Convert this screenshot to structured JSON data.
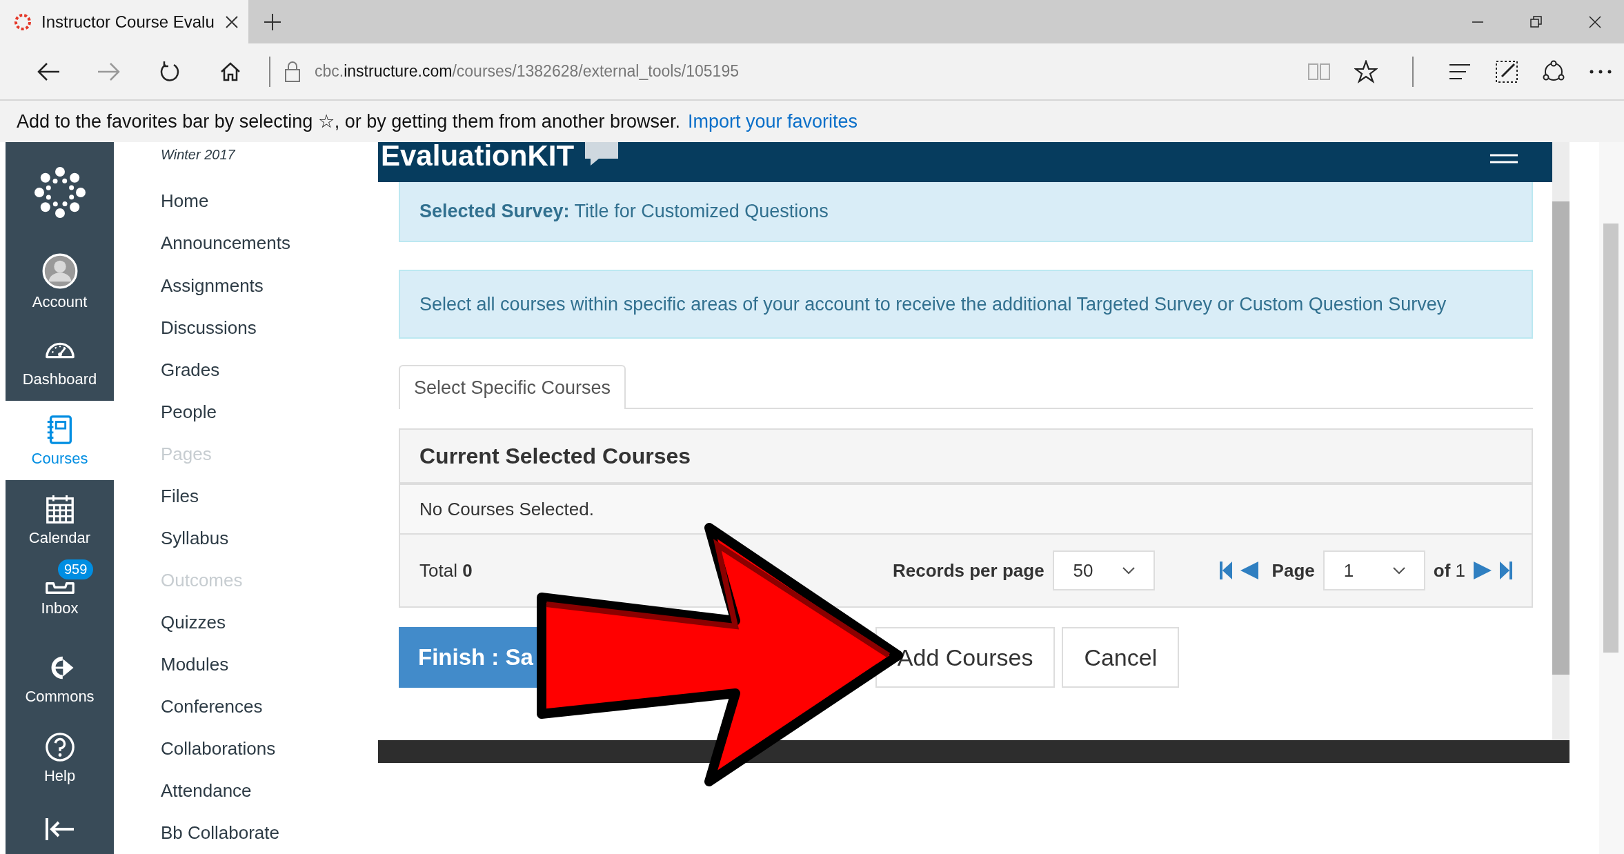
{
  "browser": {
    "tab_title": "Instructor Course Evalu",
    "url_prefix": "cbc.",
    "url_domain": "instructure.com",
    "url_path": "/courses/1382628/external_tools/105195"
  },
  "favorites_bar": {
    "message": "Add to the favorites bar by selecting ☆, or by getting them from another browser.",
    "link": "Import your favorites"
  },
  "global_nav": {
    "items": [
      {
        "label": "Account",
        "selected": false
      },
      {
        "label": "Dashboard",
        "selected": false
      },
      {
        "label": "Courses",
        "selected": true
      },
      {
        "label": "Calendar",
        "selected": false
      },
      {
        "label": "Inbox",
        "selected": false,
        "badge": "959"
      },
      {
        "label": "Commons",
        "selected": false
      },
      {
        "label": "Help",
        "selected": false
      }
    ]
  },
  "course_nav": {
    "term": "Winter 2017",
    "items": [
      {
        "label": "Home",
        "disabled": false
      },
      {
        "label": "Announcements",
        "disabled": false
      },
      {
        "label": "Assignments",
        "disabled": false
      },
      {
        "label": "Discussions",
        "disabled": false
      },
      {
        "label": "Grades",
        "disabled": false
      },
      {
        "label": "People",
        "disabled": false
      },
      {
        "label": "Pages",
        "disabled": true
      },
      {
        "label": "Files",
        "disabled": false
      },
      {
        "label": "Syllabus",
        "disabled": false
      },
      {
        "label": "Outcomes",
        "disabled": true
      },
      {
        "label": "Quizzes",
        "disabled": false
      },
      {
        "label": "Modules",
        "disabled": false
      },
      {
        "label": "Conferences",
        "disabled": false
      },
      {
        "label": "Collaborations",
        "disabled": false
      },
      {
        "label": "Attendance",
        "disabled": false
      },
      {
        "label": "Bb Collaborate",
        "disabled": false
      }
    ]
  },
  "evaluationkit": {
    "logo": "EvaluationKIT",
    "selected_survey": "**Selected Survey:** Title for Customized Questions",
    "info": "Select all courses within specific areas of your account to receive the additional Targeted Survey or Custom Question Survey",
    "tabs": [
      {
        "label": "Select Specific Courses",
        "selected": true
      }
    ],
    "panel": {
      "title": "Current Selected Courses",
      "empty_text": "No Courses Selected.",
      "total": "Total **0**",
      "records_label": "Records per page",
      "records_value": "50",
      "page_label": "Page",
      "page_value": "1",
      "page_count": "**of** 1"
    },
    "buttons": [
      {
        "label": "Finish : Sa",
        "kind": "primary"
      },
      {
        "label": "Add Courses",
        "kind": "default"
      },
      {
        "label": "Cancel",
        "kind": "default"
      }
    ]
  }
}
